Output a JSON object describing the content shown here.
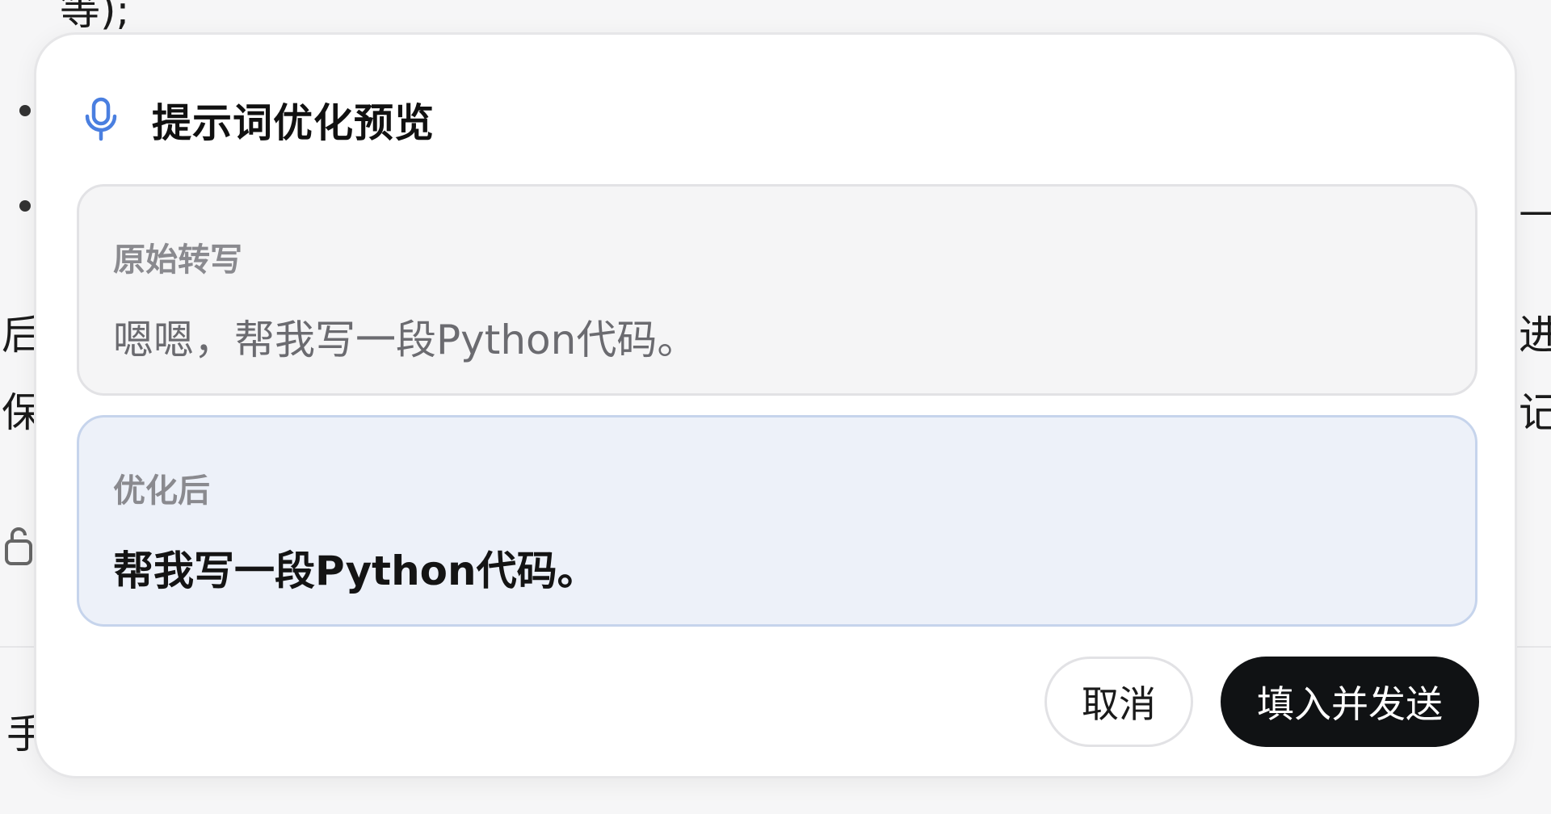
{
  "background": {
    "top_fragment": "等);",
    "left_fragments": [
      "后",
      "保",
      "手"
    ],
    "right_fragments": [
      "—",
      "进",
      "记"
    ]
  },
  "dialog": {
    "title": "提示词优化预览",
    "icon": "microphone-icon",
    "original": {
      "label": "原始转写",
      "text": "嗯嗯，帮我写一段Python代码。"
    },
    "optimized": {
      "label": "优化后",
      "text": "帮我写一段Python代码。"
    },
    "buttons": {
      "cancel": "取消",
      "send": "填入并发送"
    }
  },
  "colors": {
    "accent": "#4a7fe0",
    "optimized_bg": "#edf1f9",
    "optimized_border": "#c6d4ec",
    "primary_button": "#101214"
  }
}
